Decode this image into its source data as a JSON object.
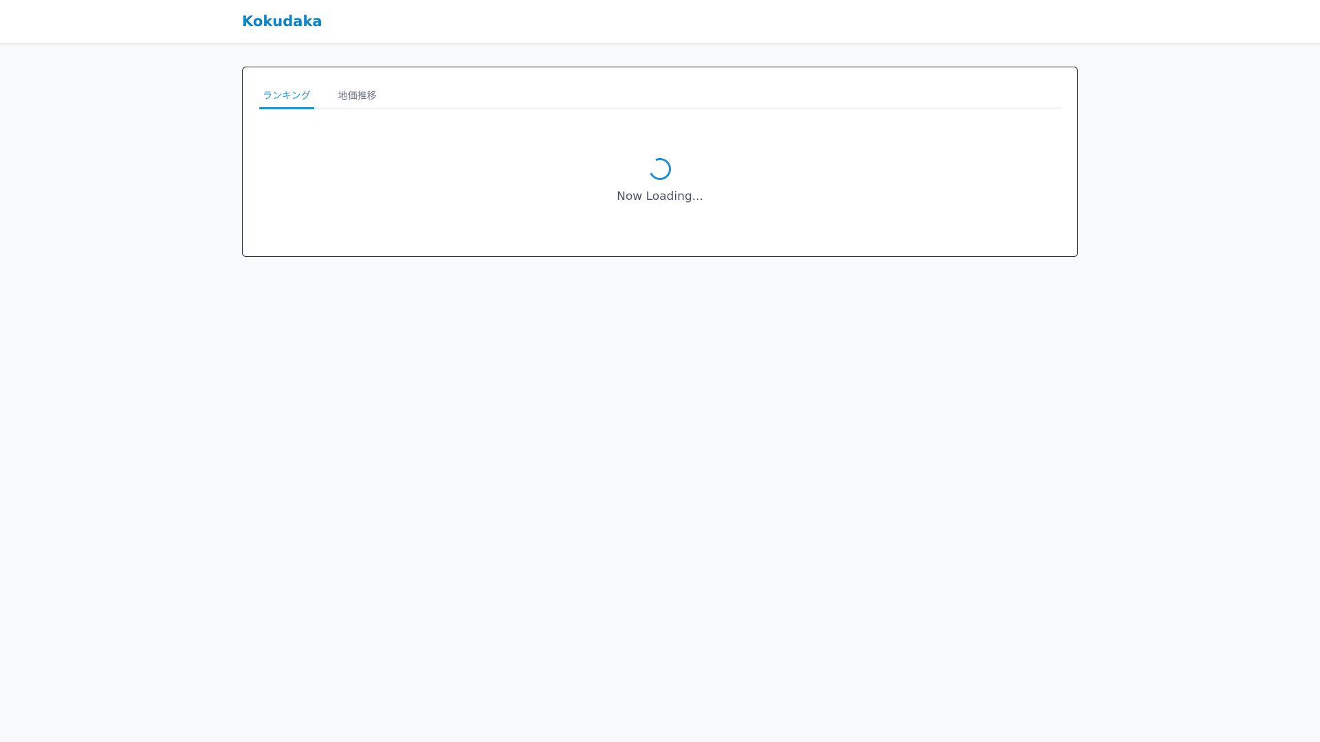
{
  "header": {
    "logo": "Kokudaka"
  },
  "tabs": [
    {
      "label": "ランキング",
      "active": true
    },
    {
      "label": "地価推移",
      "active": false
    }
  ],
  "loading": {
    "text": "Now Loading..."
  },
  "colors": {
    "accent": "#1a96d6",
    "logo": "#0a84c6"
  }
}
